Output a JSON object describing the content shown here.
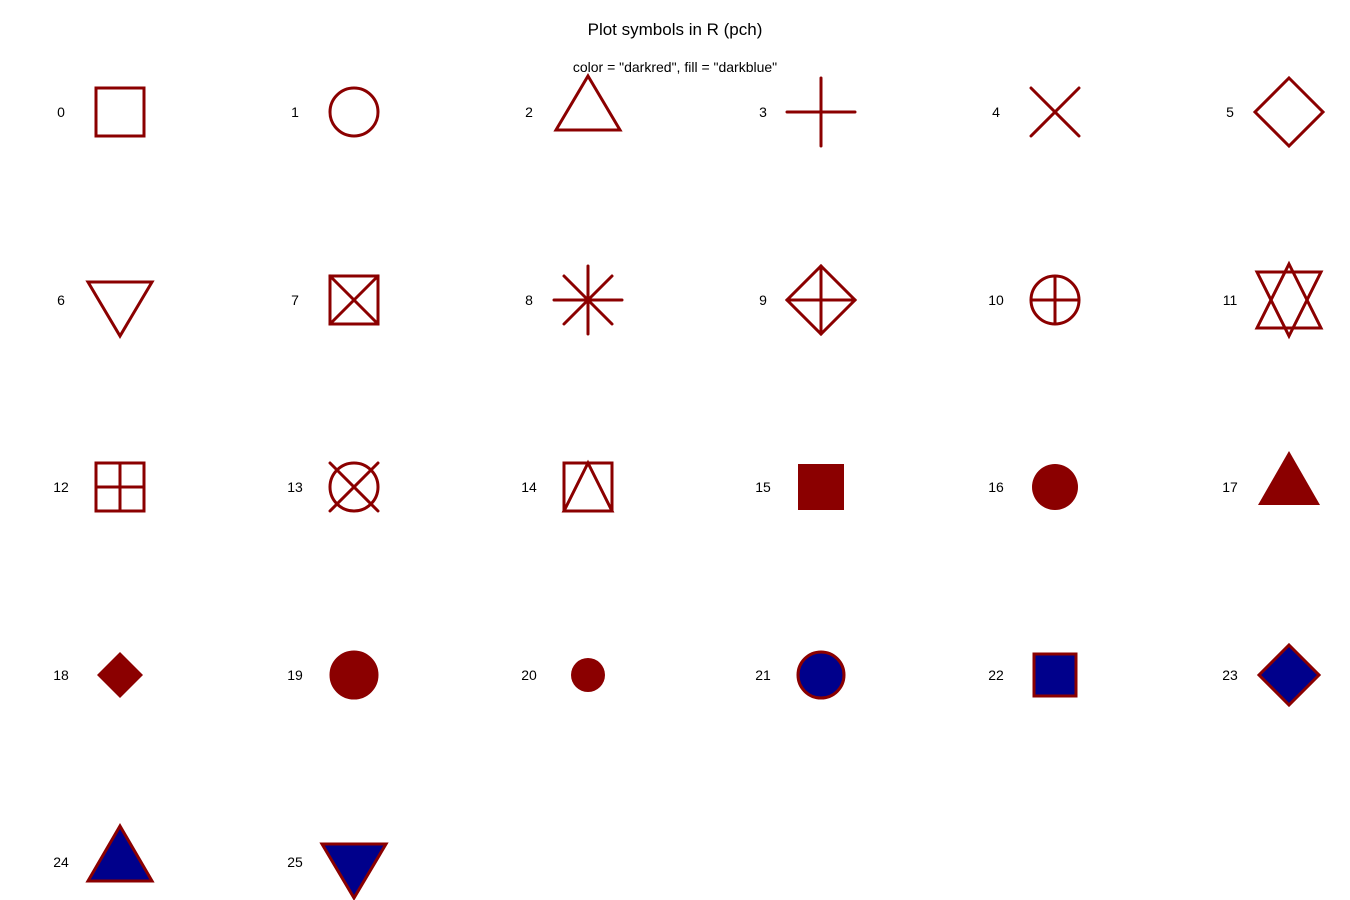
{
  "title": "Plot symbols in R (pch)",
  "subtitle": "color = \"darkred\", fill = \"darkblue\"",
  "colors": {
    "stroke": "#8b0000",
    "fill": "#00008b"
  },
  "symbols": [
    {
      "pch": "0",
      "shape": "open-square-icon"
    },
    {
      "pch": "1",
      "shape": "open-circle-icon"
    },
    {
      "pch": "2",
      "shape": "open-triangle-up-icon"
    },
    {
      "pch": "3",
      "shape": "plus-icon"
    },
    {
      "pch": "4",
      "shape": "cross-x-icon"
    },
    {
      "pch": "5",
      "shape": "open-diamond-icon"
    },
    {
      "pch": "6",
      "shape": "open-triangle-down-icon"
    },
    {
      "pch": "7",
      "shape": "square-x-icon"
    },
    {
      "pch": "8",
      "shape": "asterisk-icon"
    },
    {
      "pch": "9",
      "shape": "diamond-plus-icon"
    },
    {
      "pch": "10",
      "shape": "circle-plus-icon"
    },
    {
      "pch": "11",
      "shape": "star-of-david-icon"
    },
    {
      "pch": "12",
      "shape": "square-plus-icon"
    },
    {
      "pch": "13",
      "shape": "circle-x-icon"
    },
    {
      "pch": "14",
      "shape": "square-triangle-icon"
    },
    {
      "pch": "15",
      "shape": "filled-square-icon"
    },
    {
      "pch": "16",
      "shape": "filled-circle-icon"
    },
    {
      "pch": "17",
      "shape": "filled-triangle-up-icon"
    },
    {
      "pch": "18",
      "shape": "filled-small-diamond-icon"
    },
    {
      "pch": "19",
      "shape": "filled-large-circle-icon"
    },
    {
      "pch": "20",
      "shape": "filled-small-circle-icon"
    },
    {
      "pch": "21",
      "shape": "bordered-circle-icon"
    },
    {
      "pch": "22",
      "shape": "bordered-square-icon"
    },
    {
      "pch": "23",
      "shape": "bordered-diamond-icon"
    },
    {
      "pch": "24",
      "shape": "bordered-triangle-up-icon"
    },
    {
      "pch": "25",
      "shape": "bordered-triangle-down-icon"
    }
  ]
}
